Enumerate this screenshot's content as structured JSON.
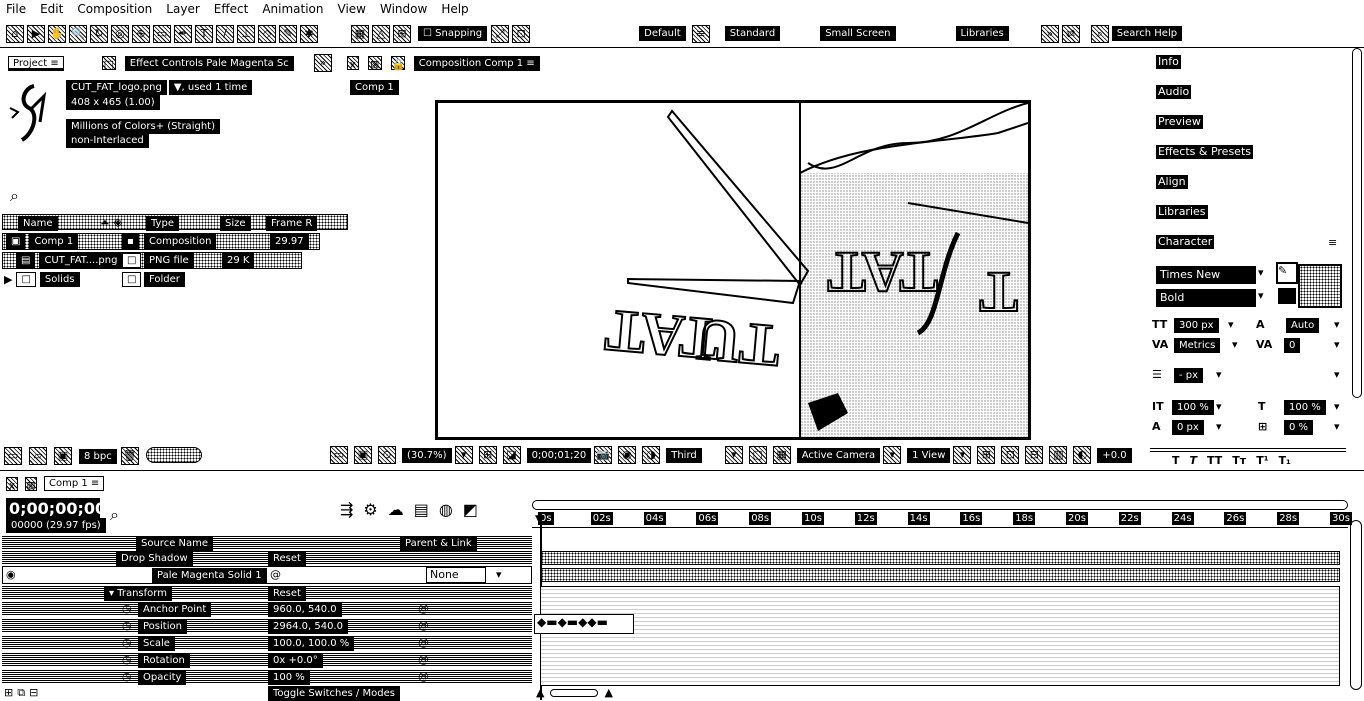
{
  "menu": [
    "File",
    "Edit",
    "Composition",
    "Layer",
    "Effect",
    "Animation",
    "View",
    "Window",
    "Help"
  ],
  "toolbar": {
    "snapping": "Snapping",
    "workspaces": [
      "Default",
      "Standard",
      "Small Screen",
      "Libraries"
    ],
    "search_help": "Search Help"
  },
  "project_panel": {
    "tab": "Project",
    "effect_controls_tab": "Effect Controls Pale Magenta Sc",
    "composition_tab": "Composition Comp 1",
    "comp_chip": "Comp 1",
    "asset_name": "CUT_FAT_logo.png",
    "asset_used": ", used 1 time",
    "asset_dims": "408 x 465 (1.00)",
    "asset_colors": "Millions of Colors+ (Straight)",
    "asset_interlace": "non-Interlaced",
    "columns": [
      "Name",
      "Type",
      "Size",
      "Frame R"
    ],
    "items": [
      {
        "name": "Comp 1",
        "type": "Composition",
        "size": "",
        "rate": "29.97"
      },
      {
        "name": "CUT_FAT....png",
        "type": "PNG file",
        "size": "29 K",
        "rate": ""
      },
      {
        "name": "Solids",
        "type": "Folder",
        "size": "",
        "rate": ""
      }
    ],
    "bpc": "8 bpc"
  },
  "viewer": {
    "zoom": "(30.7%)",
    "timecode": "0;00;01;20",
    "resolution": "Third",
    "camera": "Active Camera",
    "views": "1 View",
    "exposure": "+0.0"
  },
  "right_panel": {
    "items": [
      "Info",
      "Audio",
      "Preview",
      "Effects & Presets",
      "Align",
      "Libraries",
      "Character"
    ],
    "font": "Times New Roman",
    "style": "Bold",
    "font_size": "300 px",
    "leading": "Auto",
    "kerning": "Metrics",
    "tracking": "0",
    "stroke": "- px",
    "vscale": "100 %",
    "hscale": "100 %",
    "baseline": "0 px",
    "tsume": "0 %"
  },
  "timeline": {
    "tab": "Comp 1",
    "timecode": "0;00;00;00",
    "frames": "00000 (29.97 fps)",
    "source_name_header": "Source Name",
    "parent_header": "Parent & Link",
    "drop_shadow": "Drop Shadow",
    "reset": "Reset",
    "layer_name": "Pale Magenta Solid 1",
    "parent_value": "None",
    "transform": "Transform",
    "props": [
      {
        "name": "Anchor Point",
        "value": "960.0, 540.0"
      },
      {
        "name": "Position",
        "value": "2964.0, 540.0"
      },
      {
        "name": "Scale",
        "value": "100.0, 100.0 %"
      },
      {
        "name": "Rotation",
        "value": "0x +0.0°"
      },
      {
        "name": "Opacity",
        "value": "100 %"
      }
    ],
    "ruler": [
      "0s",
      "02s",
      "04s",
      "06s",
      "08s",
      "10s",
      "12s",
      "14s",
      "16s",
      "18s",
      "20s",
      "22s",
      "24s",
      "26s",
      "28s",
      "30s"
    ],
    "toggle": "Toggle Switches / Modes"
  }
}
